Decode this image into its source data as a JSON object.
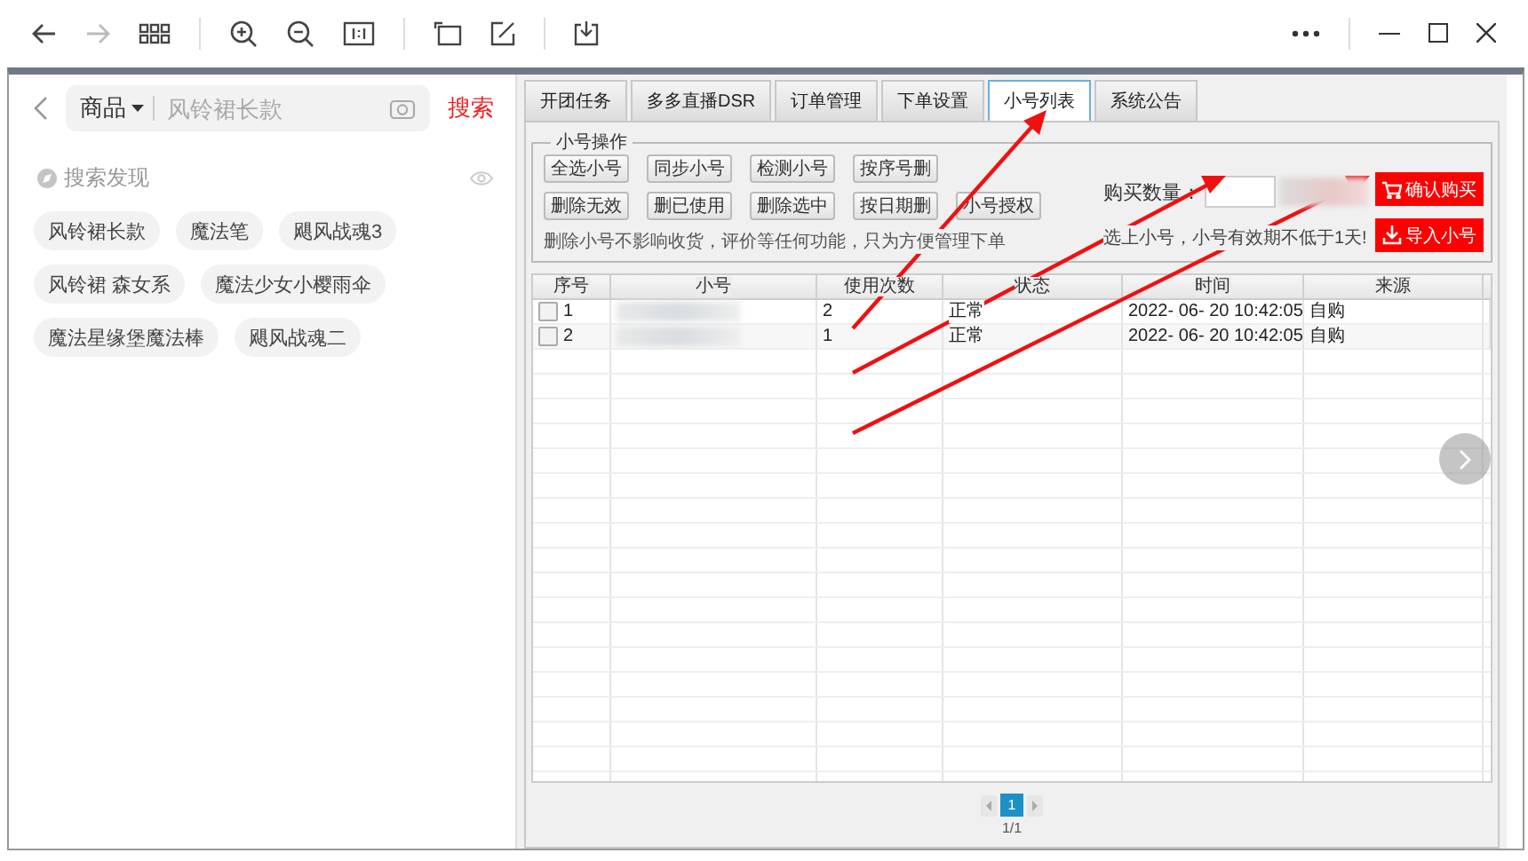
{
  "search": {
    "category": "商品",
    "placeholder": "风铃裙长款",
    "button": "搜索"
  },
  "discover": {
    "title": "搜索发现",
    "chips": [
      [
        "风铃裙长款",
        "魔法笔",
        "飓风战魂3"
      ],
      [
        "风铃裙 森女系",
        "魔法少女小樱雨伞"
      ],
      [
        "魔法星缘堡魔法棒",
        "飓风战魂二"
      ]
    ]
  },
  "tabs": [
    {
      "label": "开团任务",
      "selected": false
    },
    {
      "label": "多多直播DSR",
      "selected": false
    },
    {
      "label": "订单管理",
      "selected": false
    },
    {
      "label": "下单设置",
      "selected": false
    },
    {
      "label": "小号列表",
      "selected": true
    },
    {
      "label": "系统公告",
      "selected": false
    }
  ],
  "group": {
    "title": "小号操作",
    "buttons": [
      [
        "全选小号",
        "同步小号",
        "检测小号",
        "按序号删"
      ],
      [
        "删除无效",
        "删已使用",
        "删除选中",
        "按日期删",
        "小号授权"
      ]
    ],
    "note": "删除小号不影响收货，评价等任何功能，只为方便管理下单",
    "quantity_label": "购买数量：",
    "confirm_button": "确认购买",
    "import_button": "导入小号",
    "hint": "选上小号，小号有效期不低于1天!"
  },
  "table": {
    "columns": [
      "序号",
      "小号",
      "使用次数",
      "状态",
      "时间",
      "来源"
    ],
    "rows": [
      {
        "checked": false,
        "no": "1",
        "uses": "2",
        "status": "正常",
        "time": "2022- 06- 20 10:42:05",
        "source": "自购"
      },
      {
        "checked": false,
        "no": "2",
        "uses": "1",
        "status": "正常",
        "time": "2022- 06- 20 10:42:05",
        "source": "自购"
      }
    ]
  },
  "pagination": {
    "pages": [
      {
        "label": "1",
        "selected": true
      }
    ],
    "summary": "1/1"
  }
}
